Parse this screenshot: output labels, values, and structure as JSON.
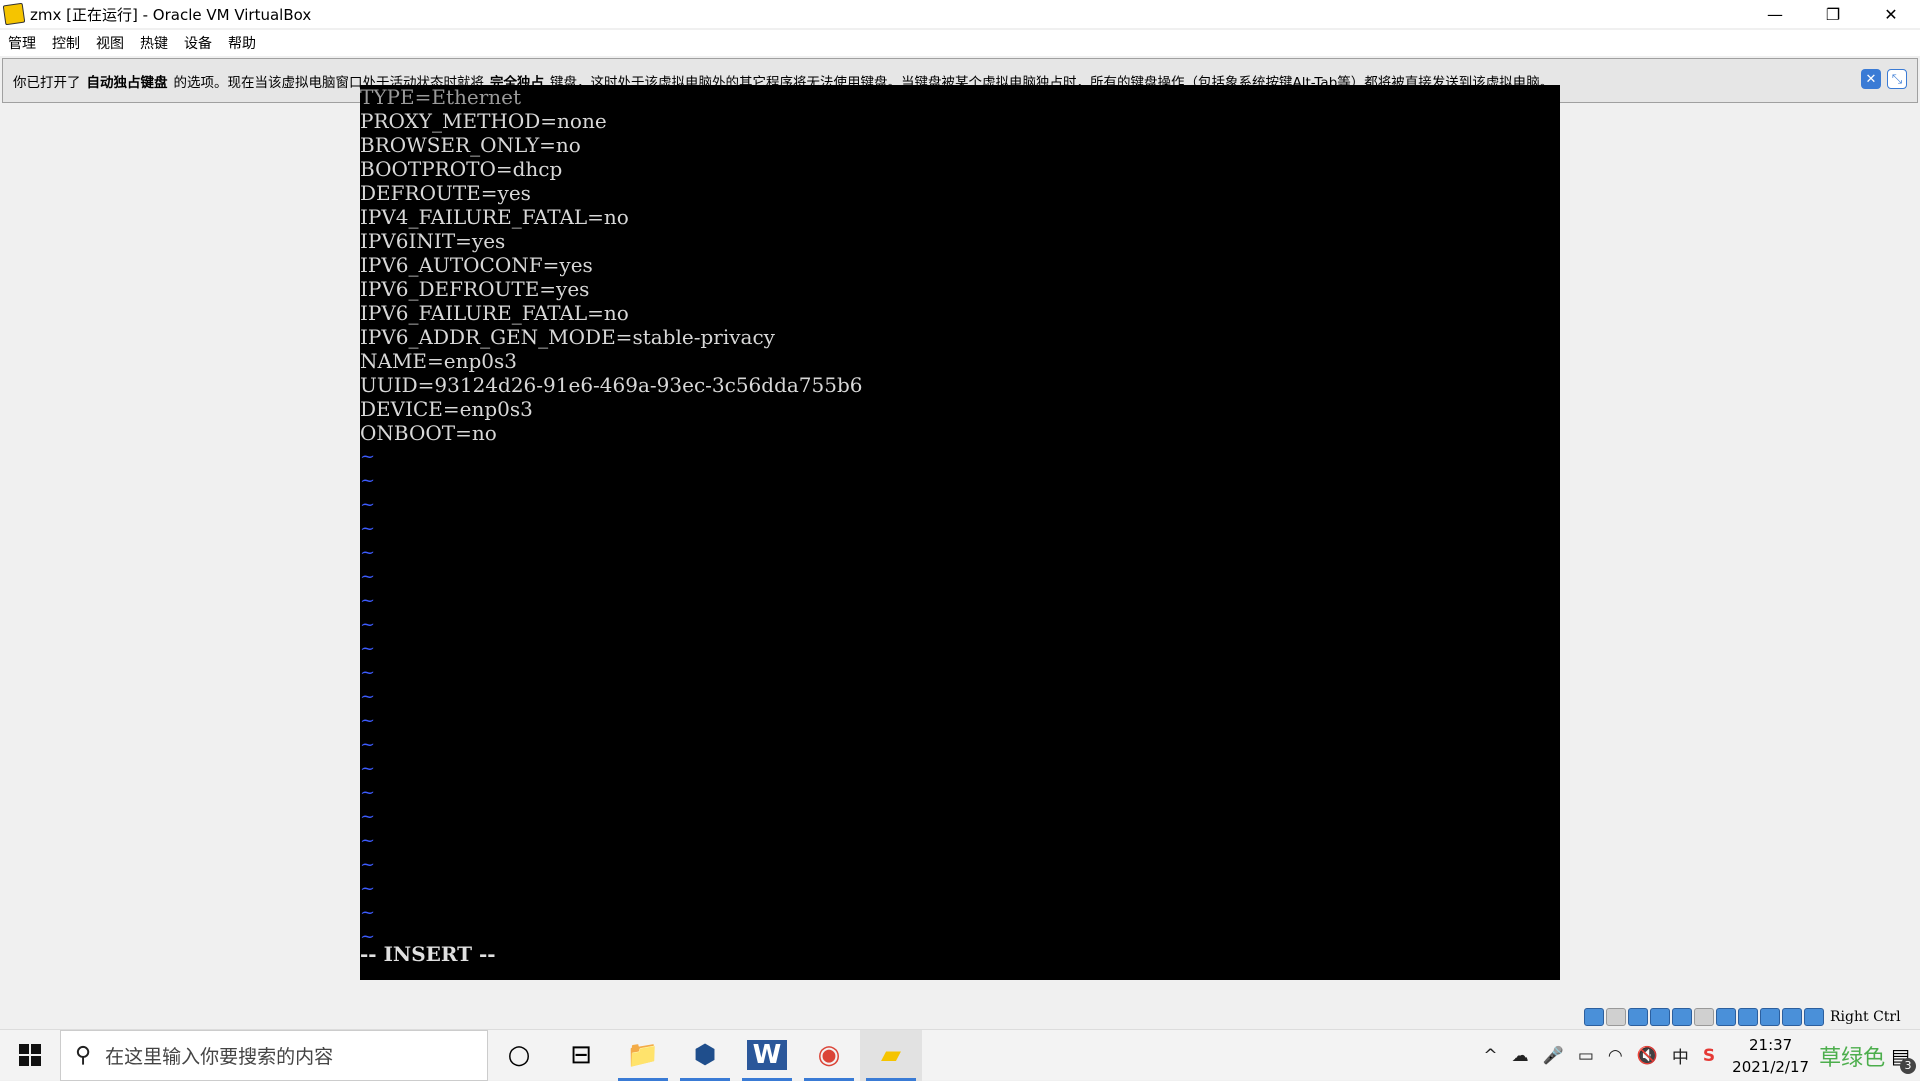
{
  "window": {
    "title": "zmx [正在运行] - Oracle VM VirtualBox",
    "minimize": "—",
    "restore": "❐",
    "close": "✕"
  },
  "menu": [
    "管理",
    "控制",
    "视图",
    "热键",
    "设备",
    "帮助"
  ],
  "notice": {
    "part1": "你已打开了",
    "bold1": "自动独占键盘",
    "part2": "的选项。现在当该虚拟电脑窗口处于活动状态时就将",
    "bold2": "完全独占",
    "part3": "键盘，这时处于该虚拟电脑外的其它程序将无法使用键盘。当键盘被某个虚拟电脑独占时，所有的键盘操作（包括象系统按键Alt-Tab等）都将被直接发送到该虚拟电脑。",
    "close_icon": "✕",
    "mute_icon": "⤡"
  },
  "terminal": {
    "lines": [
      "TYPE=Ethernet",
      "PROXY_METHOD=none",
      "BROWSER_ONLY=no",
      "BOOTPROTO=dhcp",
      "DEFROUTE=yes",
      "IPV4_FAILURE_FATAL=no",
      "IPV6INIT=yes",
      "IPV6_AUTOCONF=yes",
      "IPV6_DEFROUTE=yes",
      "IPV6_FAILURE_FATAL=no",
      "IPV6_ADDR_GEN_MODE=stable-privacy",
      "NAME=enp0s3",
      "UUID=93124d26-91e6-469a-93ec-3c56dda755b6",
      "DEVICE=enp0s3",
      "ONBOOT=no"
    ],
    "tilde": "~",
    "tilde_count": 21,
    "mode": "-- INSERT --"
  },
  "status": {
    "host_key": "Right Ctrl"
  },
  "taskbar": {
    "search_placeholder": "在这里输入你要搜索的内容",
    "search_icon": "⚲",
    "cortana_icon": "○",
    "taskview_icon": "⊟",
    "apps": [
      {
        "name": "file-explorer",
        "glyph": "📁"
      },
      {
        "name": "virtualbox",
        "glyph": "⬢"
      },
      {
        "name": "word",
        "glyph": "W"
      },
      {
        "name": "chrome",
        "glyph": "◉"
      },
      {
        "name": "virtualbox-vm",
        "glyph": "▰"
      }
    ],
    "tray": {
      "chevron": "^",
      "cloud": "☁",
      "mic": "🎤",
      "battery": "▭",
      "wifi": "◠",
      "volume": "🔇",
      "ime_lang": "中",
      "sogou": "S",
      "time": "21:37",
      "date": "2021/2/17",
      "ime_label": "草绿色",
      "notifications": "▤",
      "notification_count": "3"
    }
  },
  "colors": {
    "vm_background": "#000000",
    "tilde": "#3d5cff",
    "accent": "#3a7bd5"
  }
}
